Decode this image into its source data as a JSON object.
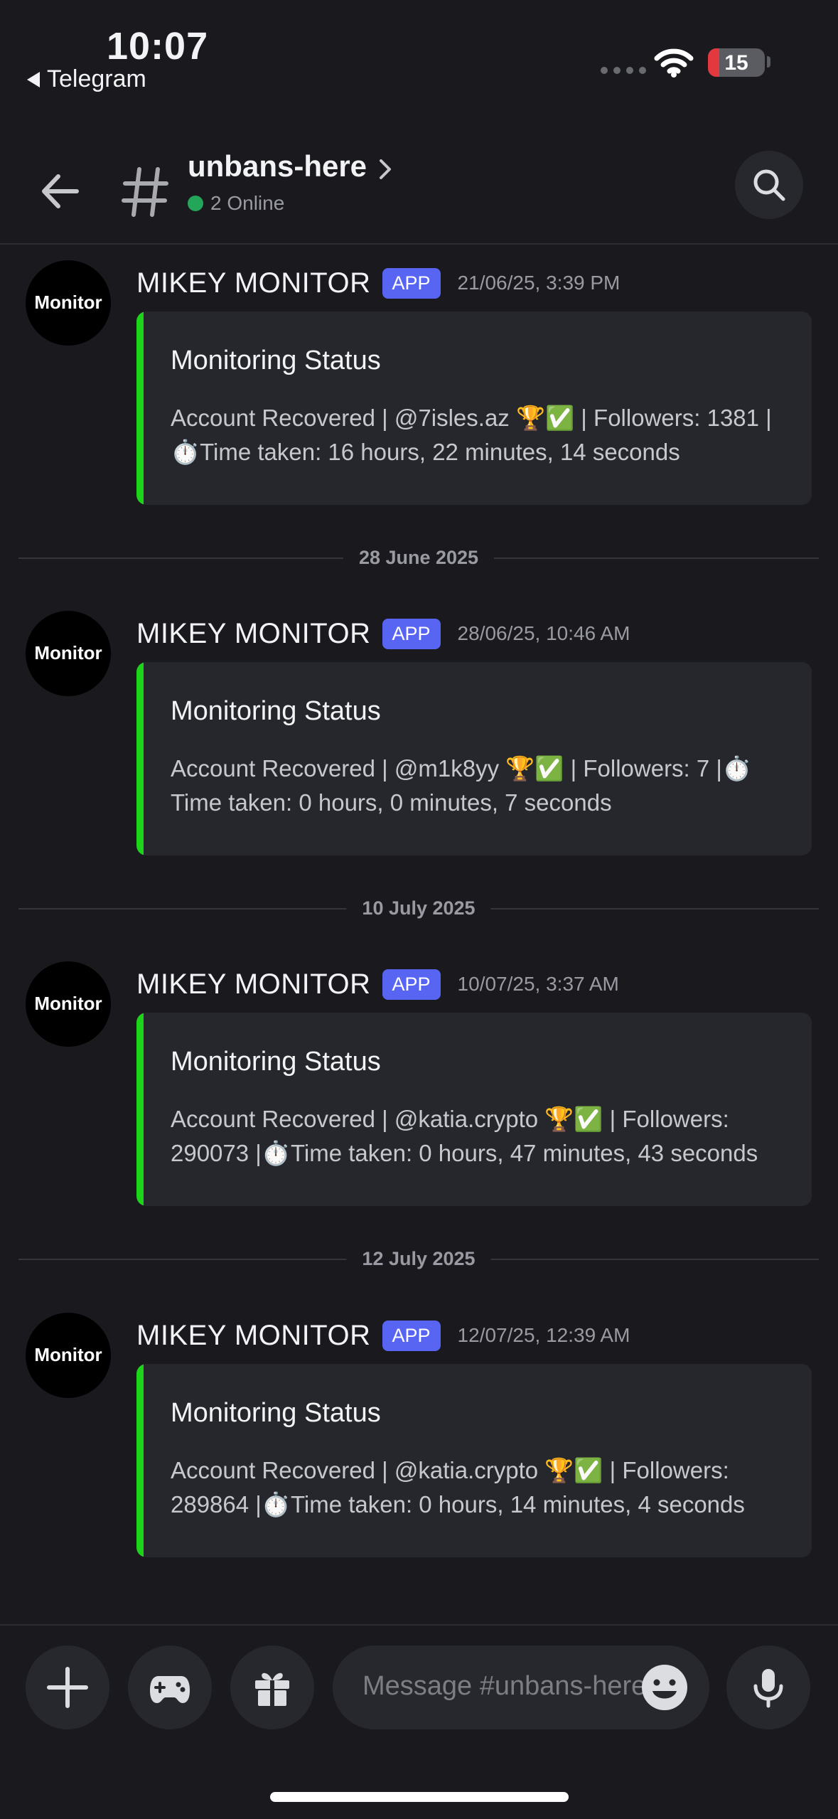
{
  "status_bar": {
    "time": "10:07",
    "back_app": "Telegram",
    "battery": "15"
  },
  "header": {
    "channel_name": "unbans-here",
    "online_text": "2 Online"
  },
  "messages": [
    {
      "avatar_text": "Monitor",
      "author": "MIKEY MONITOR",
      "badge": "APP",
      "timestamp": "21/06/25, 3:39 PM",
      "embed_title": "Monitoring Status",
      "embed_text": "Account Recovered | @7isles.az 🏆✅ | Followers: 1381 | ⏱️Time taken: 16 hours, 22 minutes, 14 seconds"
    },
    {
      "avatar_text": "Monitor",
      "author": "MIKEY MONITOR",
      "badge": "APP",
      "timestamp": "28/06/25, 10:46 AM",
      "embed_title": "Monitoring Status",
      "embed_text": "Account Recovered | @m1k8yy 🏆✅ | Followers: 7 |⏱️ Time taken: 0 hours, 0 minutes, 7 seconds"
    },
    {
      "avatar_text": "Monitor",
      "author": "MIKEY MONITOR",
      "badge": "APP",
      "timestamp": "10/07/25, 3:37 AM",
      "embed_title": "Monitoring Status",
      "embed_text": "Account Recovered | @katia.crypto 🏆✅ | Followers: 290073 |⏱️Time taken: 0 hours, 47 minutes, 43 seconds"
    },
    {
      "avatar_text": "Monitor",
      "author": "MIKEY MONITOR",
      "badge": "APP",
      "timestamp": "12/07/25, 12:39 AM",
      "embed_title": "Monitoring Status",
      "embed_text": "Account Recovered | @katia.crypto 🏆✅ | Followers: 289864 |⏱️Time taken: 0 hours, 14 minutes, 4 seconds"
    }
  ],
  "date_dividers": [
    "28 June 2025",
    "10 July 2025",
    "12 July 2025"
  ],
  "composer": {
    "placeholder": "Message #unbans-here"
  },
  "colors": {
    "background": "#1a1a1e",
    "embed_bar": "#1dd41b",
    "app_badge": "#5865f2",
    "online": "#23a55a"
  }
}
